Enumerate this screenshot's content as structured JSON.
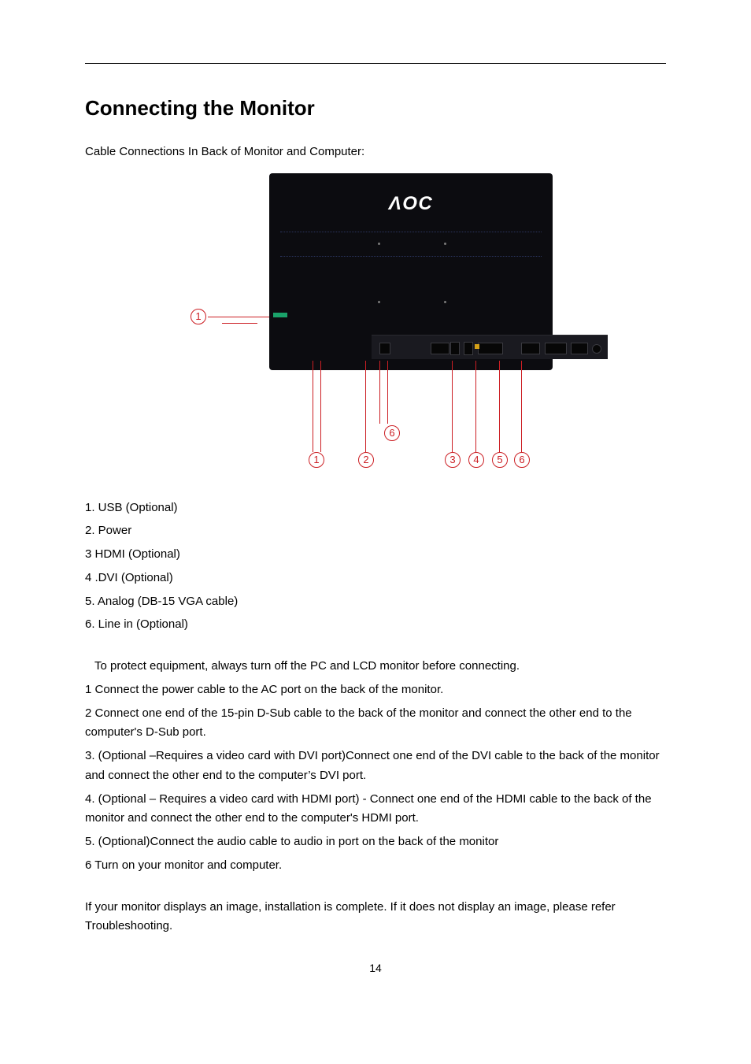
{
  "title": "Connecting the Monitor",
  "intro": "Cable Connections In Back of Monitor and Computer:",
  "monitor_brand": "ΛOC",
  "callouts": {
    "side": "1",
    "mid_upper": "6",
    "bottom": [
      "1",
      "2",
      "3",
      "4",
      "5",
      "6"
    ]
  },
  "legend": [
    "1. USB (Optional)",
    "2. Power",
    "3 HDMI (Optional)",
    "4 .DVI (Optional)",
    "5. Analog (DB-15 VGA cable)",
    "6. Line in (Optional)"
  ],
  "steps_lead": "To protect equipment, always turn off the PC and LCD monitor before connecting.",
  "steps": [
    "1     Connect the power cable to the AC port on the back of the monitor.",
    "2     Connect one end of the 15-pin D-Sub cable to the back of the monitor and connect the other end to the computer's D-Sub port.",
    "3.    (Optional –Requires a video card with DVI port)Connect one end of the DVI cable to the back of the monitor and connect the other end to the computer’s DVI port.",
    "4.    (Optional – Requires a video card with HDMI port) - Connect one end of the HDMI cable to the back of the monitor and connect the other end to the computer's HDMI port.",
    "5. (Optional)Connect the audio cable to audio in port on the back of the monitor",
    "6    Turn on your monitor and computer."
  ],
  "closing": "If your monitor displays an image, installation is complete. If it does not display an image, please refer Troubleshooting.",
  "page_number": "14"
}
